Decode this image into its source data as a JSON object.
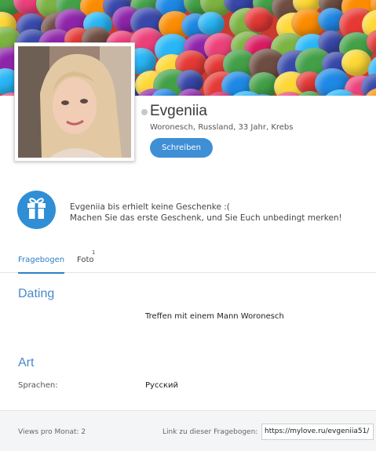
{
  "profile": {
    "name": "Evgeniia",
    "meta": "Woronesch, Russland, 33 Jahr, Krebs",
    "write_label": "Schreiben",
    "online_color": "#c8c8c8"
  },
  "gifts": {
    "line1": "Evgeniia bis erhielt keine Geschenke :(",
    "line2": "Machen Sie das erste Geschenk, und Sie Euch unbedingt merken!",
    "icon": "gift-icon"
  },
  "tabs": [
    {
      "label": "Fragebogen",
      "active": true
    },
    {
      "label": "Foto",
      "count": "1",
      "active": false
    }
  ],
  "sections": {
    "dating": {
      "title": "Dating",
      "value": "Treffen mit einem Mann Woronesch"
    },
    "art": {
      "title": "Art",
      "label": "Sprachen:",
      "value": "Русский"
    }
  },
  "footer": {
    "views": "Views pro Monat: 2",
    "link_label": "Link zu dieser Fragebogen:",
    "link_value": "https://mylove.ru/evgeniia51/"
  },
  "colors": {
    "accent": "#3f8fd6",
    "section_title": "#4a88c8"
  }
}
